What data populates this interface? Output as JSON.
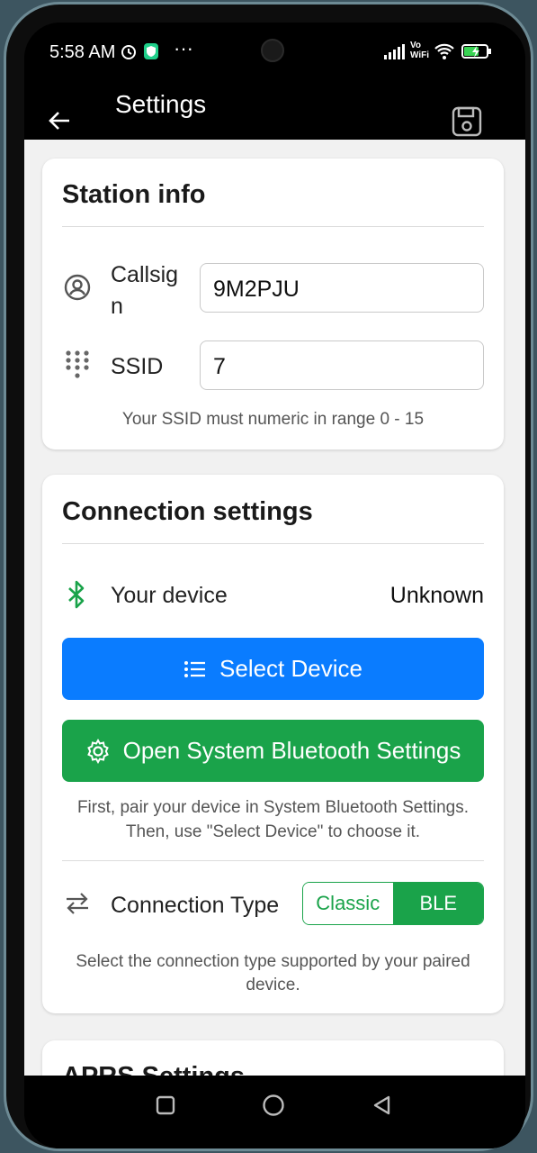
{
  "status_bar": {
    "time": "5:58 AM",
    "more": "···",
    "volte": "Vo\nWiFi"
  },
  "app_bar": {
    "title": "Settings"
  },
  "station_info": {
    "title": "Station info",
    "callsign_label": "Callsig\nn",
    "callsign_value": "9M2PJU",
    "ssid_label": "SSID",
    "ssid_value": "7",
    "ssid_hint": "Your SSID must numeric in range 0 - 15"
  },
  "connection": {
    "title": "Connection settings",
    "device_label": "Your device",
    "device_value": "Unknown",
    "select_button": "Select Device",
    "bt_settings_button": "Open System Bluetooth Settings",
    "pair_hint_1": "First, pair your device in System Bluetooth Settings.",
    "pair_hint_2": "Then, use \"Select Device\" to choose it.",
    "type_label": "Connection Type",
    "type_options": [
      "Classic",
      "BLE"
    ],
    "type_selected": "BLE",
    "type_hint_1": "Select the connection type supported by your paired",
    "type_hint_2": "device."
  },
  "aprs": {
    "title": "APRS Settings"
  },
  "colors": {
    "blue": "#0a7cff",
    "green": "#1aa34a"
  }
}
